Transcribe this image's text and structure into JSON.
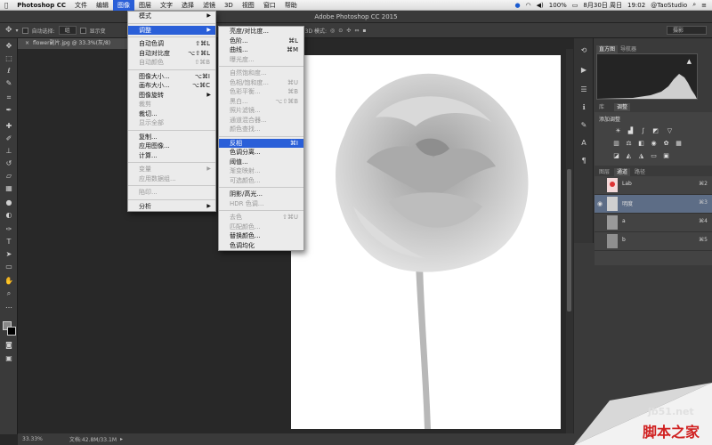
{
  "mac_menubar": {
    "app_name": "Photoshop CC",
    "items": [
      "文件",
      "编辑",
      "图像",
      "图层",
      "文字",
      "选择",
      "滤镜",
      "3D",
      "视图",
      "窗口",
      "帮助"
    ],
    "status": {
      "battery": "100%",
      "date": "8月30日 周日",
      "time": "19:02",
      "user": "@TaoStudio"
    }
  },
  "window": {
    "title": "Adobe Photoshop CC 2015"
  },
  "options_bar": {
    "auto_select": "自动选择:",
    "auto_select_value": "组",
    "show_transform": "显示变",
    "mode_3d": "3D 模式:",
    "workspace": "摄影"
  },
  "document": {
    "tab_label": "flower副片.jpg @ 33.3%(灰/8)"
  },
  "status_bar": {
    "zoom": "33.33%",
    "doc_size": "文档:42.8M/33.1M"
  },
  "image_menu": {
    "items": [
      {
        "label": "模式",
        "shortcut": "",
        "submenu": true,
        "disabled": false
      },
      {
        "sep": true
      },
      {
        "label": "调整",
        "shortcut": "",
        "submenu": true,
        "disabled": false,
        "highlight": true
      },
      {
        "sep": true
      },
      {
        "label": "自动色调",
        "shortcut": "⇧⌘L",
        "disabled": false
      },
      {
        "label": "自动对比度",
        "shortcut": "⌥⇧⌘L",
        "disabled": false
      },
      {
        "label": "自动颜色",
        "shortcut": "⇧⌘B",
        "disabled": true
      },
      {
        "sep": true
      },
      {
        "label": "图像大小...",
        "shortcut": "⌥⌘I",
        "disabled": false
      },
      {
        "label": "画布大小...",
        "shortcut": "⌥⌘C",
        "disabled": false
      },
      {
        "label": "图像旋转",
        "shortcut": "",
        "submenu": true,
        "disabled": false
      },
      {
        "label": "裁剪",
        "shortcut": "",
        "disabled": true
      },
      {
        "label": "裁切...",
        "shortcut": "",
        "disabled": false
      },
      {
        "label": "显示全部",
        "shortcut": "",
        "disabled": true
      },
      {
        "sep": true
      },
      {
        "label": "复制...",
        "shortcut": "",
        "disabled": false
      },
      {
        "label": "应用图像...",
        "shortcut": "",
        "disabled": false
      },
      {
        "label": "计算...",
        "shortcut": "",
        "disabled": false
      },
      {
        "sep": true
      },
      {
        "label": "变量",
        "shortcut": "",
        "submenu": true,
        "disabled": true
      },
      {
        "label": "应用数据组...",
        "shortcut": "",
        "disabled": true
      },
      {
        "sep": true
      },
      {
        "label": "陷印...",
        "shortcut": "",
        "disabled": true
      },
      {
        "sep": true
      },
      {
        "label": "分析",
        "shortcut": "",
        "submenu": true,
        "disabled": false
      }
    ]
  },
  "adjust_submenu": {
    "items": [
      {
        "label": "亮度/对比度...",
        "shortcut": "",
        "disabled": false
      },
      {
        "label": "色阶...",
        "shortcut": "⌘L",
        "disabled": false
      },
      {
        "label": "曲线...",
        "shortcut": "⌘M",
        "disabled": false
      },
      {
        "label": "曝光度...",
        "shortcut": "",
        "disabled": true
      },
      {
        "sep": true
      },
      {
        "label": "自然饱和度...",
        "shortcut": "",
        "disabled": true
      },
      {
        "label": "色相/饱和度...",
        "shortcut": "⌘U",
        "disabled": true
      },
      {
        "label": "色彩平衡...",
        "shortcut": "⌘B",
        "disabled": true
      },
      {
        "label": "黑白...",
        "shortcut": "⌥⇧⌘B",
        "disabled": true
      },
      {
        "label": "照片滤镜...",
        "shortcut": "",
        "disabled": true
      },
      {
        "label": "通道混合器...",
        "shortcut": "",
        "disabled": true
      },
      {
        "label": "颜色查找...",
        "shortcut": "",
        "disabled": true
      },
      {
        "sep": true
      },
      {
        "label": "反相",
        "shortcut": "⌘I",
        "disabled": false,
        "highlight": true
      },
      {
        "label": "色调分离...",
        "shortcut": "",
        "disabled": false
      },
      {
        "label": "阈值...",
        "shortcut": "",
        "disabled": false
      },
      {
        "label": "渐变映射...",
        "shortcut": "",
        "disabled": true
      },
      {
        "label": "可选颜色...",
        "shortcut": "",
        "disabled": true
      },
      {
        "sep": true
      },
      {
        "label": "阴影/高光...",
        "shortcut": "",
        "disabled": false
      },
      {
        "label": "HDR 色调...",
        "shortcut": "",
        "disabled": true
      },
      {
        "sep": true
      },
      {
        "label": "去色",
        "shortcut": "⇧⌘U",
        "disabled": true
      },
      {
        "label": "匹配颜色...",
        "shortcut": "",
        "disabled": true
      },
      {
        "label": "替换颜色...",
        "shortcut": "",
        "disabled": false
      },
      {
        "label": "色调均化",
        "shortcut": "",
        "disabled": false
      }
    ]
  },
  "panels": {
    "tabs_top": [
      "直方图",
      "导航器"
    ],
    "tabs_adj": [
      "库",
      "调整"
    ],
    "add_adjustment": "添加调整",
    "tabs_channels": [
      "图层",
      "通道",
      "路径"
    ],
    "channels": [
      {
        "name": "Lab",
        "shortcut": "⌘2",
        "selected": false
      },
      {
        "name": "明度",
        "shortcut": "⌘3",
        "selected": true
      },
      {
        "name": "a",
        "shortcut": "⌘4",
        "selected": false
      },
      {
        "name": "b",
        "shortcut": "⌘5",
        "selected": false
      }
    ]
  },
  "watermark": {
    "line1": "jb51.net",
    "line2": "脚本之家"
  },
  "colors": {
    "highlight": "#2a5fd8",
    "channel_selected": "#5d6d86"
  }
}
